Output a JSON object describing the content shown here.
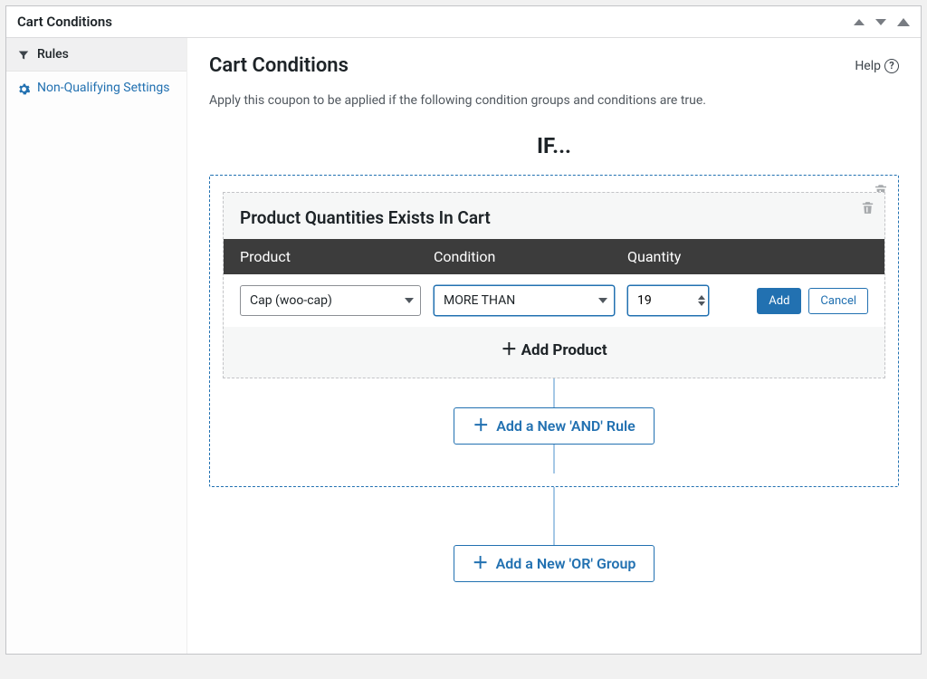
{
  "panel_title": "Cart Conditions",
  "sidebar": {
    "items": [
      {
        "label": "Rules"
      },
      {
        "label": "Non-Qualifying Settings"
      }
    ]
  },
  "main": {
    "title": "Cart Conditions",
    "help_label": "Help",
    "subtitle": "Apply this coupon to be applied if the following condition groups and conditions are true.",
    "if_label": "IF...",
    "rule": {
      "title": "Product Quantities Exists In Cart",
      "columns": {
        "product": "Product",
        "condition": "Condition",
        "quantity": "Quantity"
      },
      "row": {
        "product": "Cap (woo-cap)",
        "condition": "MORE THAN",
        "quantity": "19",
        "add_label": "Add",
        "cancel_label": "Cancel"
      },
      "add_product_label": "Add Product"
    },
    "add_and_label": "Add a New 'AND' Rule",
    "add_or_label": "Add a New 'OR' Group"
  }
}
